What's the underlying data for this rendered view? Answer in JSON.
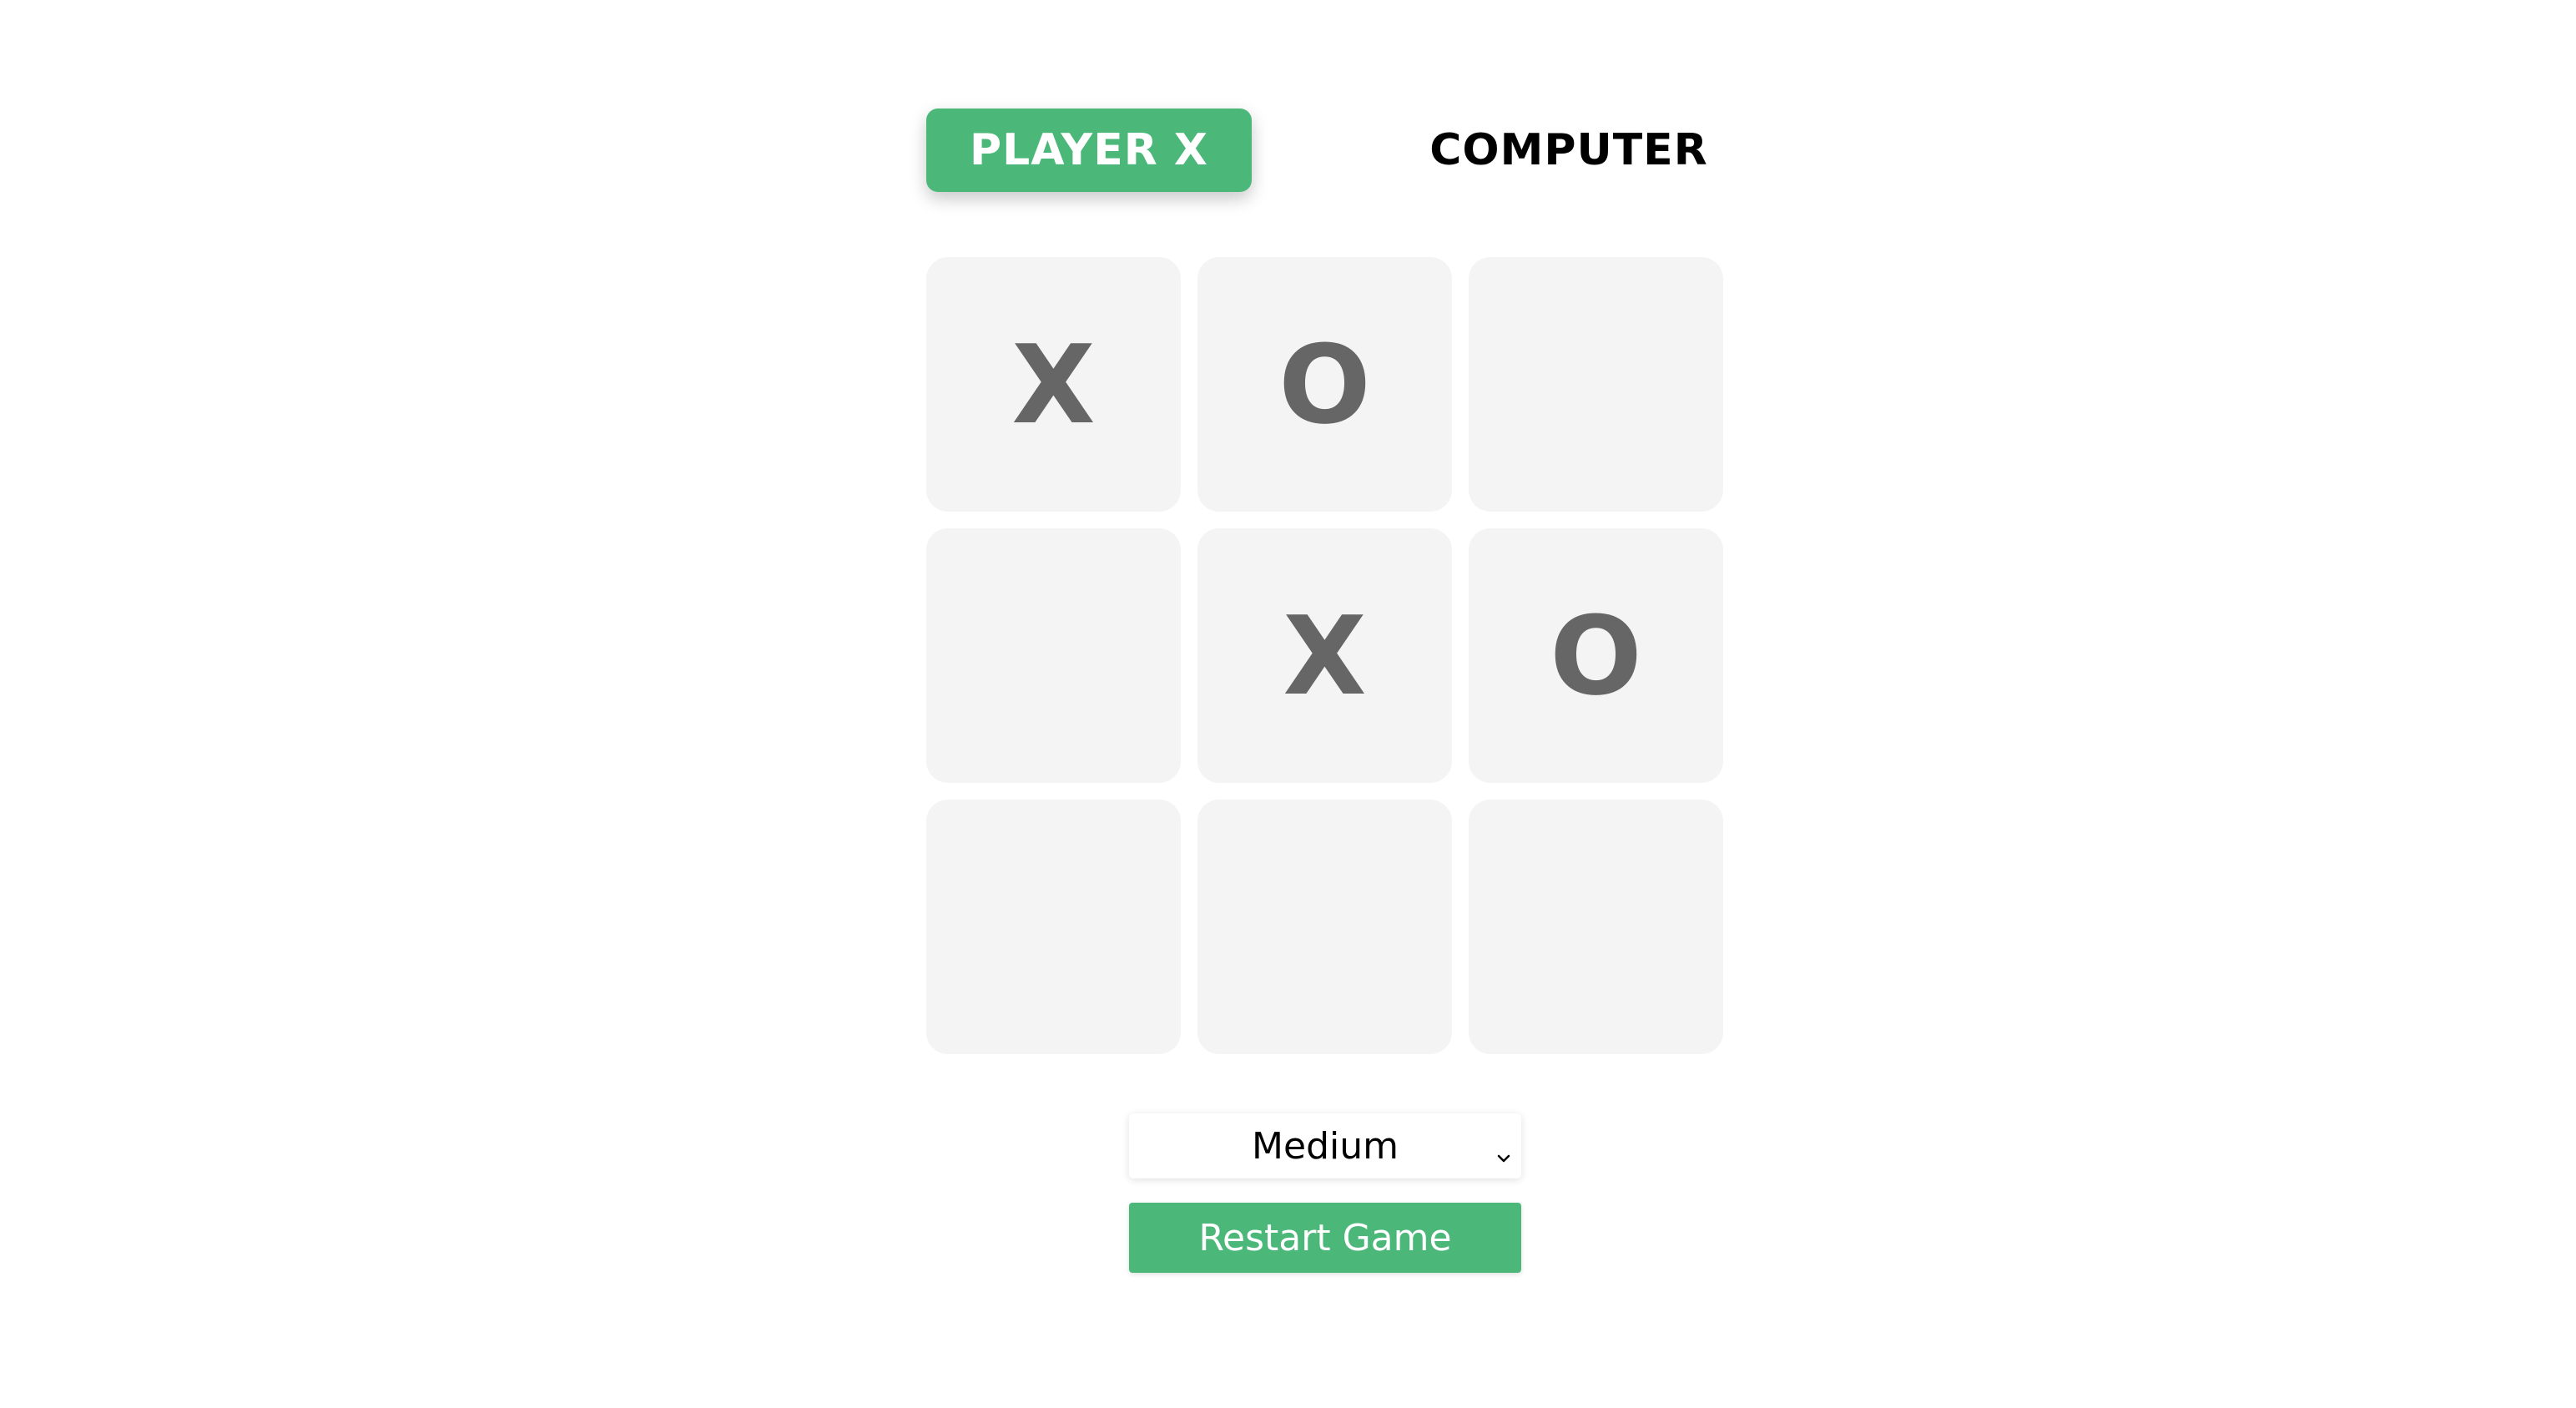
{
  "header": {
    "title": ""
  },
  "turn_indicator": {
    "player_label": "PLAYER X",
    "computer_label": "COMPUTER",
    "active": "player"
  },
  "board": {
    "cells": [
      "X",
      "O",
      "",
      "",
      "X",
      "O",
      "",
      "",
      ""
    ]
  },
  "controls": {
    "difficulty": {
      "selected": "Medium",
      "icon": "chevron-down-icon"
    },
    "restart_label": "Restart Game"
  },
  "colors": {
    "accent": "#4bb87a",
    "cell_background": "#f4f4f4",
    "mark_color": "#666666"
  }
}
